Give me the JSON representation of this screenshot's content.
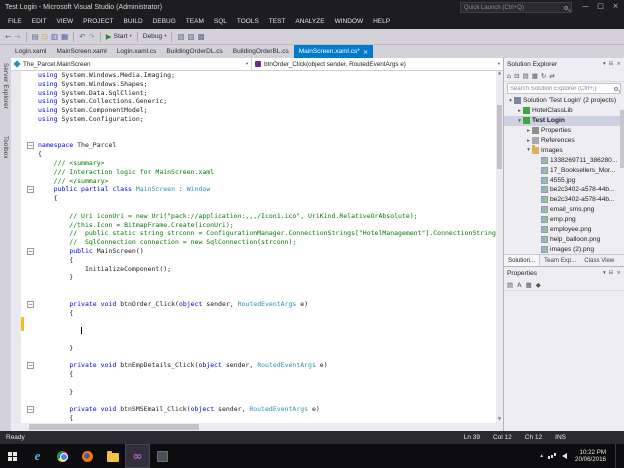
{
  "colors": {
    "accent": "#007ACC",
    "keyword": "#0000E6",
    "comment": "#007A00",
    "type": "#2B91AF",
    "change_track": "#F2BC19"
  },
  "title_bar": {
    "title": "Test Login - Microsoft Visual Studio (Administrator)",
    "quick_launch": "Quick Launch (Ctrl+Q)",
    "window_buttons": {
      "minimize": "—",
      "maximize": "□",
      "close": "×"
    }
  },
  "menu_bar": {
    "items": [
      "FILE",
      "EDIT",
      "VIEW",
      "PROJECT",
      "BUILD",
      "DEBUG",
      "TEAM",
      "SQL",
      "TOOLS",
      "TEST",
      "ANALYZE",
      "WINDOW",
      "HELP"
    ]
  },
  "toolbar": {
    "items": [
      {
        "name": "nav-back-icon",
        "glyph": "←",
        "type": "icon",
        "color": "#3B6EA5"
      },
      {
        "name": "nav-forward-icon",
        "glyph": "→",
        "type": "icon",
        "color": "#8A9AB0"
      },
      {
        "name": "toolbar-separator",
        "type": "sep"
      },
      {
        "name": "new-file-icon",
        "glyph": "▤",
        "type": "icon",
        "color": "#5A6B8C"
      },
      {
        "name": "open-file-icon",
        "glyph": "⊡",
        "type": "icon",
        "color": "#C8A451"
      },
      {
        "name": "save-icon",
        "glyph": "▥",
        "type": "icon",
        "color": "#4E5FA8"
      },
      {
        "name": "save-all-icon",
        "glyph": "▦",
        "type": "icon",
        "color": "#4E5FA8"
      },
      {
        "name": "toolbar-separator",
        "type": "sep"
      },
      {
        "name": "undo-icon",
        "glyph": "↶",
        "type": "icon",
        "color": "#3B6EA5"
      },
      {
        "name": "redo-icon",
        "glyph": "↷",
        "type": "icon",
        "color": "#8A9AB0"
      },
      {
        "name": "toolbar-separator",
        "type": "sep"
      },
      {
        "name": "start-debug-button",
        "glyph": "▶",
        "label": "Start",
        "type": "button",
        "color": "#2E8B2E",
        "dropdown": true
      },
      {
        "name": "toolbar-separator",
        "type": "sep"
      },
      {
        "name": "solution-config-dropdown",
        "label": "Debug",
        "type": "dropdown"
      },
      {
        "name": "toolbar-separator",
        "type": "sep"
      },
      {
        "name": "find-icon",
        "glyph": "▧",
        "type": "icon",
        "color": "#5A6B8C"
      },
      {
        "name": "comment-icon",
        "glyph": "▨",
        "type": "icon",
        "color": "#5A6B8C"
      },
      {
        "name": "indent-icon",
        "glyph": "▩",
        "type": "icon",
        "color": "#5A6B8C"
      }
    ]
  },
  "document_tabs": [
    {
      "label": "Login.xaml",
      "active": false
    },
    {
      "label": "MainScreen.xaml",
      "active": false
    },
    {
      "label": "Login.xaml.cs",
      "active": false
    },
    {
      "label": "BuildingOrderDL.cs",
      "active": false
    },
    {
      "label": "BuildingOrderBL.cs",
      "active": false
    },
    {
      "label": "MainScreen.xaml.cs*",
      "active": true
    }
  ],
  "left_tool_tabs": [
    "Server Explorer",
    "Toolbox"
  ],
  "navigation_bar": {
    "type_dropdown": "The_Parcel.MainScreen",
    "member_dropdown": "btnOrder_Click(object sender, RoutedEventArgs e)"
  },
  "editor": {
    "lines": [
      {
        "t": [
          [
            "k",
            "using"
          ],
          [
            "p",
            " System.Windows.Media.Imaging;"
          ]
        ]
      },
      {
        "t": [
          [
            "k",
            "using"
          ],
          [
            "p",
            " System.Windows.Shapes;"
          ]
        ]
      },
      {
        "t": [
          [
            "k",
            "using"
          ],
          [
            "p",
            " System.Data.SqlClient;"
          ]
        ]
      },
      {
        "t": [
          [
            "k",
            "using"
          ],
          [
            "p",
            " System.Collections.Generic;"
          ]
        ]
      },
      {
        "t": [
          [
            "k",
            "using"
          ],
          [
            "p",
            " System.ComponentModel;"
          ]
        ]
      },
      {
        "t": [
          [
            "k",
            "using"
          ],
          [
            "p",
            " System.Configuration;"
          ]
        ]
      },
      {
        "t": []
      },
      {
        "t": []
      },
      {
        "fold": true,
        "t": [
          [
            "k",
            "namespace"
          ],
          [
            "p",
            " The_Parcel"
          ]
        ]
      },
      {
        "t": [
          [
            "p",
            "{"
          ]
        ]
      },
      {
        "t": [
          [
            "c",
            "    /// <summary>"
          ]
        ]
      },
      {
        "t": [
          [
            "c",
            "    /// Interaction logic for MainScreen.xaml"
          ]
        ]
      },
      {
        "t": [
          [
            "c",
            "    /// </summary>"
          ]
        ]
      },
      {
        "fold": true,
        "t": [
          [
            "p",
            "    "
          ],
          [
            "k",
            "public partial class"
          ],
          [
            "p",
            " "
          ],
          [
            "t",
            "MainScreen"
          ],
          [
            "p",
            " : "
          ],
          [
            "t",
            "Window"
          ]
        ]
      },
      {
        "t": [
          [
            "p",
            "    {"
          ]
        ]
      },
      {
        "t": []
      },
      {
        "t": [
          [
            "c",
            "        // Uri iconUri = new Uri(\"pack://application:,,,/Icon1.ico\", UriKind.RelativeOrAbsolute);"
          ]
        ]
      },
      {
        "t": [
          [
            "c",
            "        //this.Icon = BitmapFrame.Create(iconUri);"
          ]
        ]
      },
      {
        "t": [
          [
            "c",
            "        //  public static string strconn = ConfigurationManager.ConnectionStrings[\"HotelManagement\"].ConnectionString;"
          ]
        ]
      },
      {
        "t": [
          [
            "c",
            "        //  SqlConnection connection = new SqlConnection(strconn);"
          ]
        ]
      },
      {
        "fold": true,
        "t": [
          [
            "p",
            "        "
          ],
          [
            "k",
            "public"
          ],
          [
            "p",
            " MainScreen()"
          ]
        ]
      },
      {
        "t": [
          [
            "p",
            "        {"
          ]
        ]
      },
      {
        "t": [
          [
            "p",
            "            InitializeComponent();"
          ]
        ]
      },
      {
        "t": [
          [
            "p",
            "        }"
          ]
        ]
      },
      {
        "t": []
      },
      {
        "t": []
      },
      {
        "fold": true,
        "t": [
          [
            "p",
            "        "
          ],
          [
            "k",
            "private void"
          ],
          [
            "p",
            " btnOrder_Click("
          ],
          [
            "k",
            "object"
          ],
          [
            "p",
            " sender, "
          ],
          [
            "t",
            "RoutedEventArgs"
          ],
          [
            "p",
            " e)"
          ]
        ]
      },
      {
        "t": [
          [
            "p",
            "        {"
          ]
        ]
      },
      {
        "t": []
      },
      {
        "caret": true,
        "t": [
          [
            "p",
            "           "
          ]
        ]
      },
      {
        "t": []
      },
      {
        "t": [
          [
            "p",
            "        }"
          ]
        ]
      },
      {
        "t": []
      },
      {
        "fold": true,
        "t": [
          [
            "p",
            "        "
          ],
          [
            "k",
            "private void"
          ],
          [
            "p",
            " btnEmpDetails_Click("
          ],
          [
            "k",
            "object"
          ],
          [
            "p",
            " sender, "
          ],
          [
            "t",
            "RoutedEventArgs"
          ],
          [
            "p",
            " e)"
          ]
        ]
      },
      {
        "t": [
          [
            "p",
            "        {"
          ]
        ]
      },
      {
        "t": []
      },
      {
        "t": [
          [
            "p",
            "        }"
          ]
        ]
      },
      {
        "t": []
      },
      {
        "fold": true,
        "t": [
          [
            "p",
            "        "
          ],
          [
            "k",
            "private void"
          ],
          [
            "p",
            " btnSMSEmail_Click("
          ],
          [
            "k",
            "object"
          ],
          [
            "p",
            " sender, "
          ],
          [
            "t",
            "RoutedEventArgs"
          ],
          [
            "p",
            " e)"
          ]
        ]
      },
      {
        "t": [
          [
            "p",
            "        {"
          ]
        ]
      }
    ]
  },
  "solution_explorer": {
    "title": "Solution Explorer",
    "header_icons": [
      {
        "name": "chevron-down-icon",
        "glyph": "▾"
      },
      {
        "name": "pin-icon",
        "glyph": "⊟"
      },
      {
        "name": "close-icon",
        "glyph": "×"
      }
    ],
    "toolbar_icons": [
      {
        "name": "home-icon",
        "glyph": "⌂"
      },
      {
        "name": "collapse-all-icon",
        "glyph": "⊟"
      },
      {
        "name": "properties-icon",
        "glyph": "▤"
      },
      {
        "name": "show-all-files-icon",
        "glyph": "▦"
      },
      {
        "name": "refresh-icon",
        "glyph": "↻"
      },
      {
        "name": "sync-icon",
        "glyph": "⇄"
      }
    ],
    "search_placeholder": "Search Solution Explorer (Ctrl+;)",
    "tree": [
      {
        "label": "Solution 'Test Login' (2 projects)",
        "level": 0,
        "icon": "solution",
        "expander": "expanded"
      },
      {
        "label": "HotelClassLib",
        "level": 1,
        "icon": "project",
        "expander": "collapsed"
      },
      {
        "label": "Test Login",
        "level": 1,
        "icon": "project",
        "expander": "expanded",
        "selected": true,
        "bold": true
      },
      {
        "label": "Properties",
        "level": 2,
        "icon": "properties",
        "expander": "collapsed"
      },
      {
        "label": "References",
        "level": 2,
        "icon": "references",
        "expander": "collapsed"
      },
      {
        "label": "Images",
        "level": 2,
        "icon": "folder",
        "expander": "expanded"
      },
      {
        "label": "1338269711_386280...",
        "level": 3,
        "icon": "image"
      },
      {
        "label": "17_Booksellers_Mor...",
        "level": 3,
        "icon": "image"
      },
      {
        "label": "4555.jpg",
        "level": 3,
        "icon": "image"
      },
      {
        "label": "be2c3402-a578-44b...",
        "level": 3,
        "icon": "image"
      },
      {
        "label": "be2c3402-a578-44b...",
        "level": 3,
        "icon": "image"
      },
      {
        "label": "email_sms.png",
        "level": 3,
        "icon": "image"
      },
      {
        "label": "emp.png",
        "level": 3,
        "icon": "image"
      },
      {
        "label": "employee.png",
        "level": 3,
        "icon": "image"
      },
      {
        "label": "help_balloon.png",
        "level": 3,
        "icon": "image"
      },
      {
        "label": "images (2).png",
        "level": 3,
        "icon": "image"
      }
    ],
    "bottom_tabs": [
      {
        "label": "Solution...",
        "active": true
      },
      {
        "label": "Team Exp...",
        "active": false
      },
      {
        "label": "Class View",
        "active": false
      }
    ]
  },
  "properties_panel": {
    "title": "Properties",
    "header_icons": [
      {
        "name": "chevron-down-icon",
        "glyph": "▾"
      },
      {
        "name": "pin-icon",
        "glyph": "⊟"
      },
      {
        "name": "close-icon",
        "glyph": "×"
      }
    ],
    "toolbar_icons": [
      {
        "name": "categorized-icon",
        "glyph": "▤"
      },
      {
        "name": "alphabetical-icon",
        "glyph": "A"
      },
      {
        "name": "property-pages-icon",
        "glyph": "▦"
      },
      {
        "name": "events-icon",
        "glyph": "◆"
      }
    ]
  },
  "status_bar": {
    "message": "Ready",
    "line": "Ln 39",
    "column": "Col 12",
    "character": "Ch 12",
    "mode": "INS"
  },
  "taskbar": {
    "icons": [
      {
        "name": "start-button",
        "key": "start",
        "active": false
      },
      {
        "name": "internet-explorer-icon",
        "key": "ie",
        "active": false
      },
      {
        "name": "chrome-icon",
        "key": "chrome",
        "active": false
      },
      {
        "name": "firefox-icon",
        "key": "firefox",
        "active": false
      },
      {
        "name": "file-explorer-icon",
        "key": "folder",
        "active": false
      },
      {
        "name": "visual-studio-icon",
        "key": "vs",
        "active": true
      },
      {
        "name": "app-icon",
        "key": "app",
        "active": false
      }
    ],
    "tray": {
      "icons": [
        {
          "name": "hidden-icons-icon",
          "key": "chevron",
          "glyph": "▴"
        },
        {
          "name": "network-icon",
          "key": "network"
        },
        {
          "name": "volume-icon",
          "key": "volume"
        }
      ],
      "time": "10:22 PM",
      "date": "20/06/2016"
    }
  }
}
